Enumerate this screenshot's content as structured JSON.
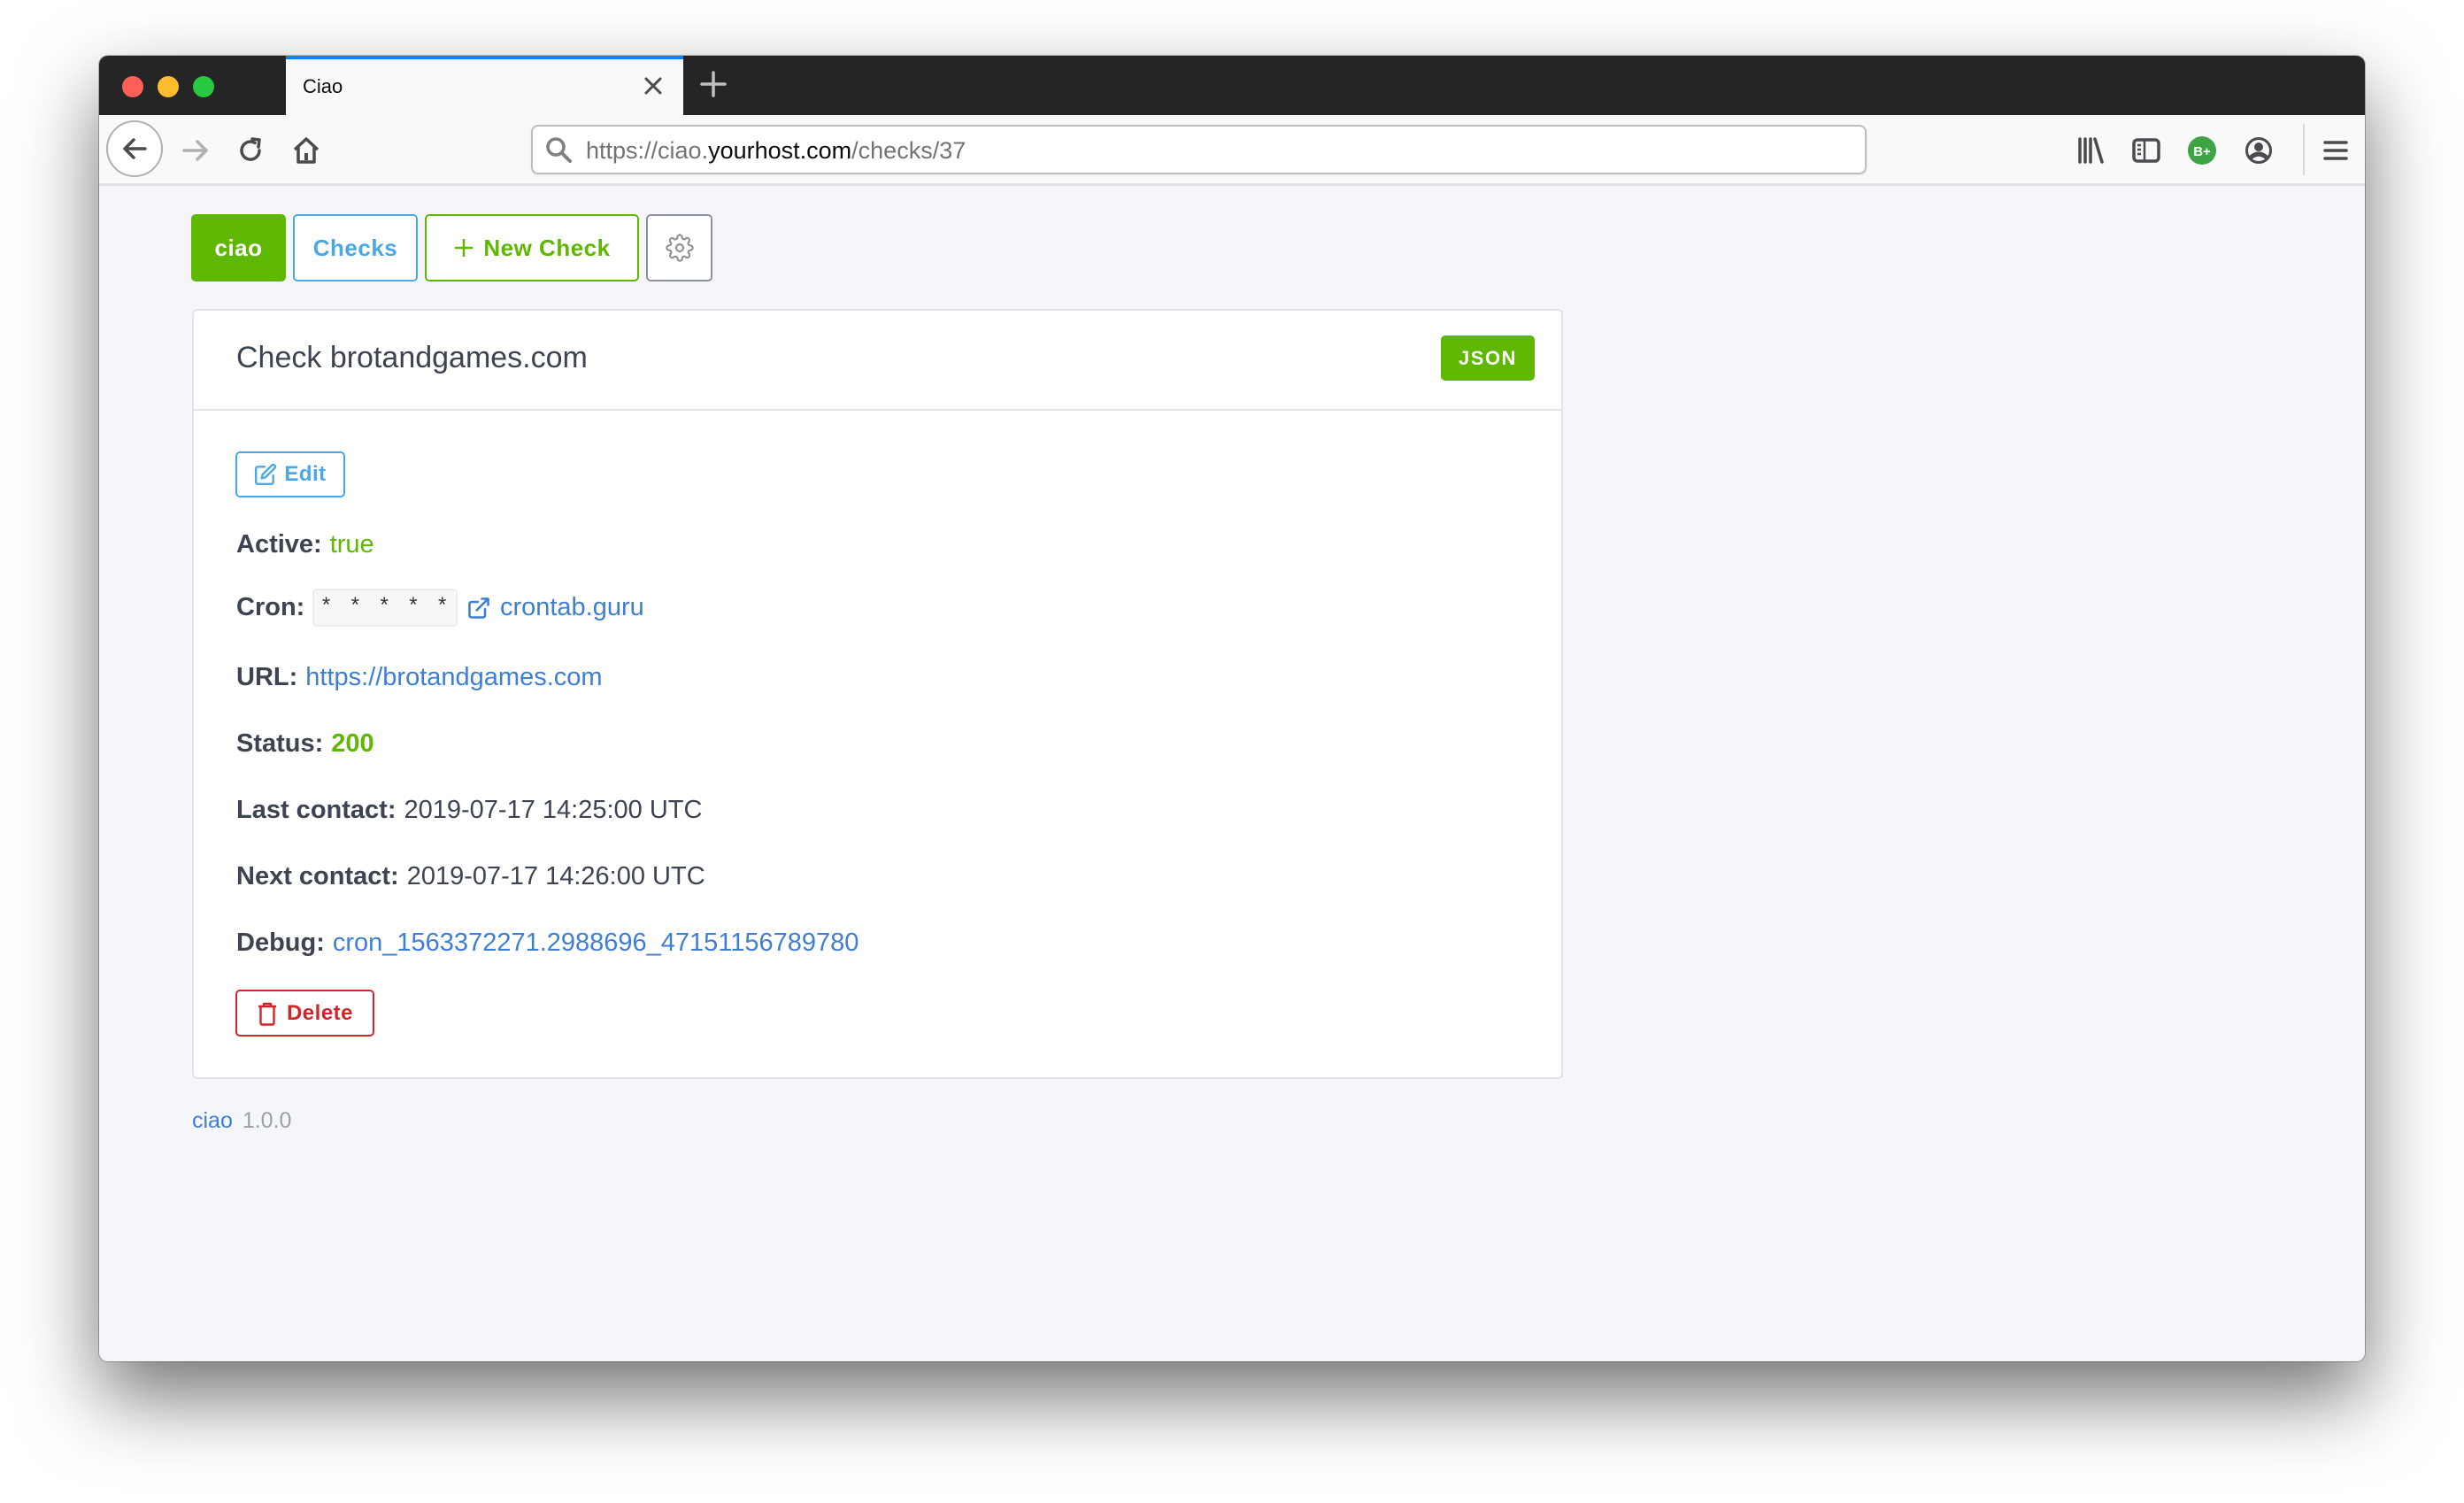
{
  "browser": {
    "tab": {
      "title": "Ciao"
    },
    "url": {
      "scheme_prefix": "https://ciao.",
      "host": "yourhost.com",
      "path": "/checks/37"
    },
    "toolbar_icons": [
      "back-icon",
      "forward-icon",
      "reload-icon",
      "home-icon",
      "library-icon",
      "sidebar-icon",
      "extension-badge-icon",
      "account-icon",
      "menu-icon"
    ],
    "extension_badge": {
      "label": "B+",
      "color": "#3ea344"
    }
  },
  "nav": {
    "brand_label": "ciao",
    "checks_label": "Checks",
    "new_check_label": "New Check",
    "settings_icon": "gear-icon"
  },
  "check": {
    "title": "Check brotandgames.com",
    "json_label": "JSON",
    "edit_label": "Edit",
    "fields": {
      "active": {
        "label": "Active:",
        "value": "true"
      },
      "cron": {
        "label": "Cron:",
        "value": "* * * * *",
        "link_label": "crontab.guru"
      },
      "url": {
        "label": "URL:",
        "value": "https://brotandgames.com"
      },
      "status": {
        "label": "Status:",
        "value": "200"
      },
      "last_contact": {
        "label": "Last contact:",
        "value": "2019-07-17 14:25:00 UTC"
      },
      "next_contact": {
        "label": "Next contact:",
        "value": "2019-07-17 14:26:00 UTC"
      },
      "debug": {
        "label": "Debug:",
        "value": "cron_1563372271.2988696_47151156789780"
      }
    },
    "delete_label": "Delete"
  },
  "footer": {
    "app_link": "ciao",
    "version": "1.0.0"
  },
  "colors": {
    "brand_green": "#5fb800",
    "info_blue": "#4aa8e6",
    "link_blue": "#3f7fd3",
    "danger_red": "#d0262b",
    "text_dark": "#3d4350",
    "page_bg": "#f5f6fa",
    "tab_accent": "#0a84ff"
  }
}
